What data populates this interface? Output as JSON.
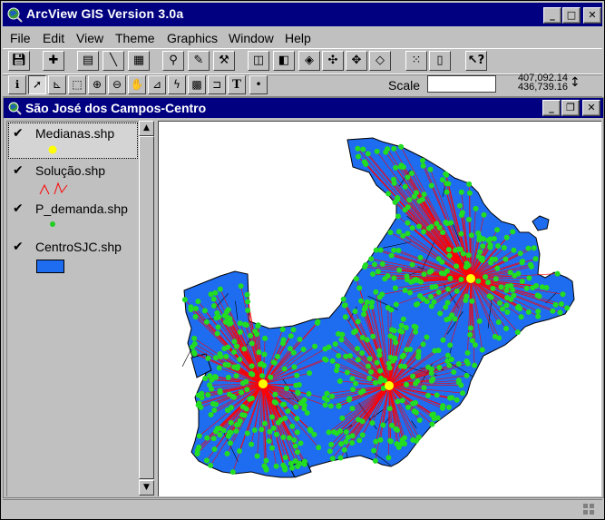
{
  "app": {
    "title": "ArcView GIS Version 3.0a",
    "window_buttons": [
      "_",
      "□",
      "✕"
    ]
  },
  "menu": [
    "File",
    "Edit",
    "View",
    "Theme",
    "Graphics",
    "Window",
    "Help"
  ],
  "toolbar_icons": [
    "save-icon",
    "add-theme-icon",
    "theme-properties-icon",
    "edit-legend-icon",
    "open-table-icon",
    "find-icon",
    "locate-address-icon",
    "query-builder-icon",
    "select-by-theme-icon",
    "clear-selection-icon",
    "zoom-to-extent-icon",
    "zoom-to-active-icon",
    "zoom-to-selected-icon",
    "zoom-previous-icon",
    "select-all-icon",
    "layout-icon",
    "help-icon"
  ],
  "tools": [
    "identify-icon",
    "pointer-icon",
    "vertex-edit-icon",
    "select-feature-icon",
    "zoom-in-icon",
    "zoom-out-icon",
    "pan-icon",
    "measure-icon",
    "hotlink-icon",
    "area-select-icon",
    "label-icon",
    "text-icon",
    "draw-point-icon"
  ],
  "scale": {
    "label": "Scale",
    "value": ""
  },
  "coordinates": {
    "x": "407,092.14",
    "y": "436,739.16"
  },
  "view": {
    "title": "São José dos Campos-Centro",
    "window_buttons": [
      "_",
      "❐",
      "✕"
    ]
  },
  "themes": [
    {
      "name": "Medianas.shp",
      "checked": true,
      "legend": "yellow-dot"
    },
    {
      "name": "Solução.shp",
      "checked": true,
      "legend": "red-lines"
    },
    {
      "name": "P_demanda.shp",
      "checked": true,
      "legend": "green-dot"
    },
    {
      "name": "CentroSJC.shp",
      "checked": true,
      "legend": "blue-polygon"
    }
  ],
  "colors": {
    "titlebar": "#000080",
    "polygon": "#1e6cf0",
    "demand": "#22dd22",
    "median": "#ffff00",
    "solution": "#ff0000"
  },
  "map": {
    "medians": [
      [
        115,
        289
      ],
      [
        254,
        291
      ],
      [
        344,
        173
      ]
    ],
    "demand_point_count": 650
  }
}
